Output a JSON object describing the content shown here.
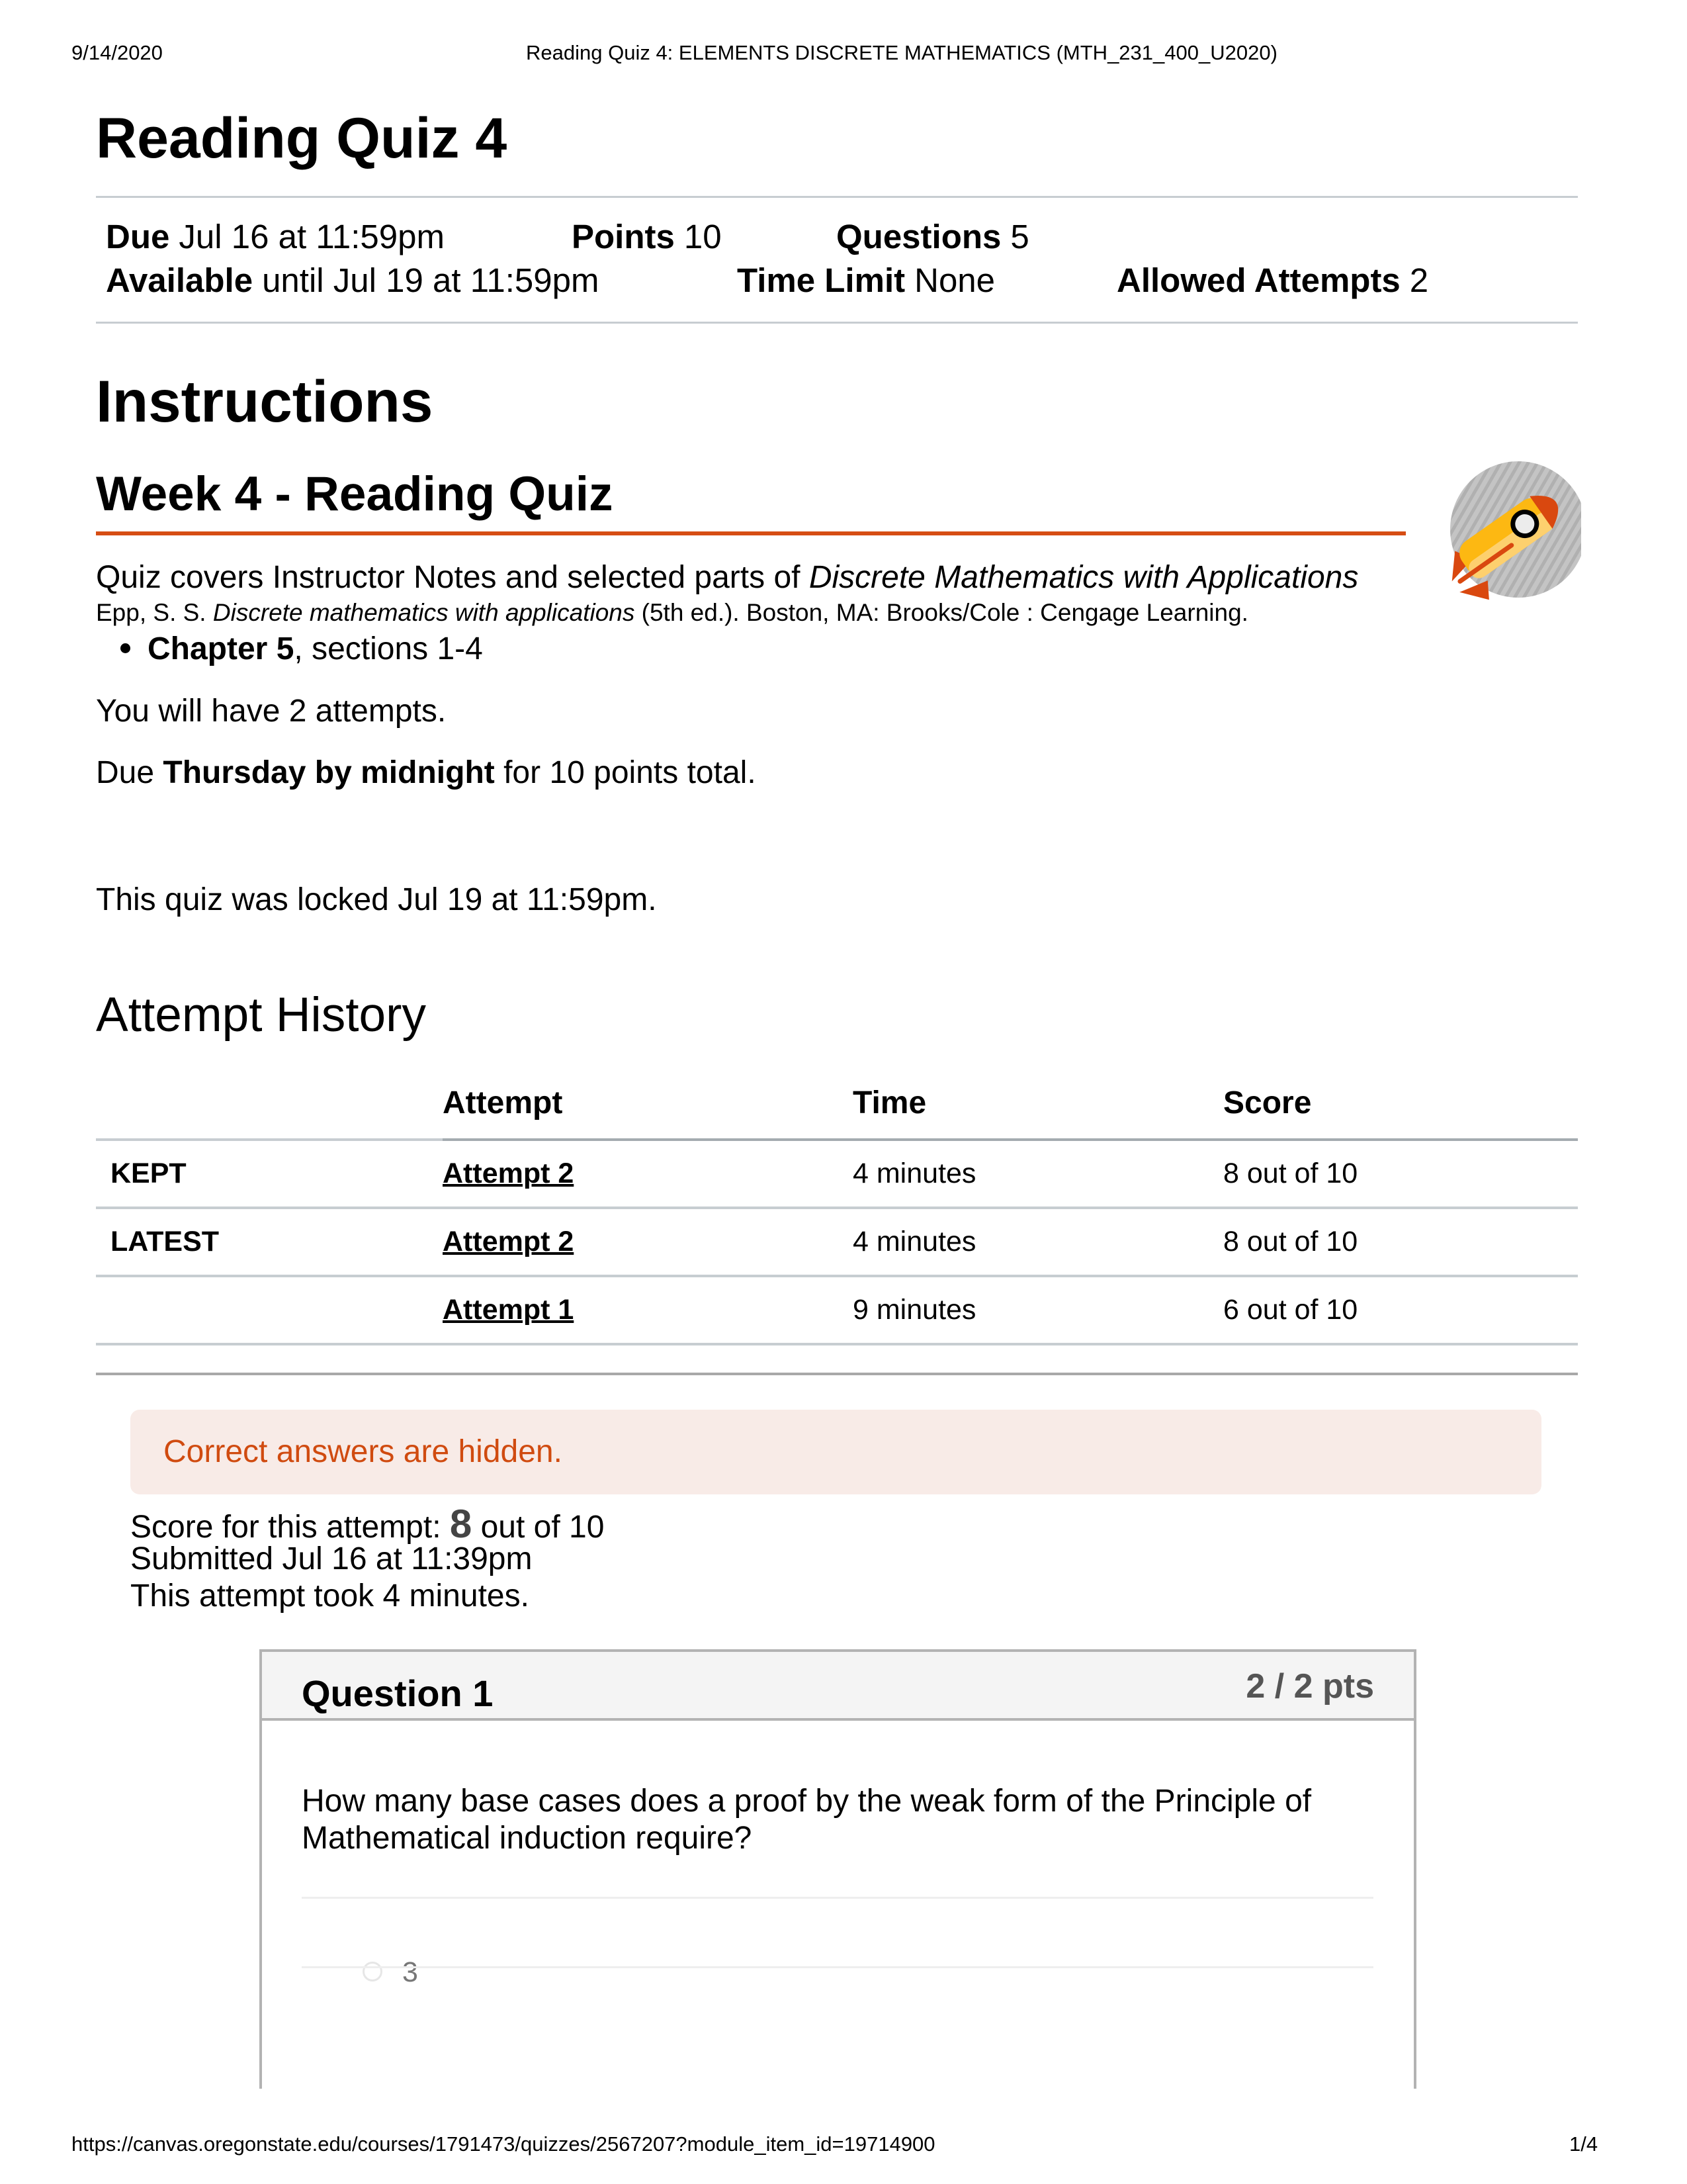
{
  "print_header": {
    "date": "9/14/2020",
    "page_title": "Reading Quiz 4: ELEMENTS DISCRETE MATHEMATICS (MTH_231_400_U2020)"
  },
  "quiz": {
    "title": "Reading Quiz 4",
    "details": {
      "due_label": "Due",
      "due_value": "Jul 16 at 11:59pm",
      "points_label": "Points",
      "points_value": "10",
      "questions_label": "Questions",
      "questions_value": "5",
      "available_label": "Available",
      "available_value": "until Jul 19 at 11:59pm",
      "time_limit_label": "Time Limit",
      "time_limit_value": "None",
      "allowed_attempts_label": "Allowed Attempts",
      "allowed_attempts_value": "2"
    }
  },
  "instructions": {
    "heading": "Instructions",
    "subheading": "Week 4 - Reading Quiz",
    "rocket_icon": "rocket-icon",
    "covers_prefix": "Quiz covers Instructor Notes and selected parts of ",
    "covers_book": "Discrete Mathematics with Applications",
    "citation_author": "Epp, S. S. ",
    "citation_title": "Discrete mathematics with applications",
    "citation_rest": " (5th ed.). Boston, MA: Brooks/Cole : Cengage Learning.",
    "bullet_bold": "Chapter 5",
    "bullet_rest": ", sections 1-4",
    "attempts_text": "You will have 2 attempts.",
    "due_prefix": "Due ",
    "due_bold": "Thursday by midnight",
    "due_suffix": " for 10 points total.",
    "locked_text": "This quiz was locked Jul 19 at 11:59pm."
  },
  "attempt_history": {
    "heading": "Attempt History",
    "columns": [
      "",
      "Attempt",
      "Time",
      "Score"
    ],
    "rows": [
      {
        "label": "KEPT",
        "attempt": "Attempt 2",
        "time": "4 minutes",
        "score": "8 out of 10"
      },
      {
        "label": "LATEST",
        "attempt": "Attempt 2",
        "time": "4 minutes",
        "score": "8 out of 10"
      },
      {
        "label": "",
        "attempt": "Attempt 1",
        "time": "9 minutes",
        "score": "6 out of 10"
      }
    ]
  },
  "submission": {
    "alert": "Correct answers are hidden.",
    "alert_color": "#d04b10",
    "score_prefix": "Score for this attempt: ",
    "score_value": "8",
    "score_suffix": " out of 10",
    "submitted": "Submitted Jul 16 at 11:39pm",
    "duration": "This attempt took 4 minutes."
  },
  "questions": [
    {
      "title": "Question 1",
      "points": "2 / 2 pts",
      "text": "How many base cases does a proof by the weak form of the Principle of Mathematical induction require?",
      "answers": [
        {
          "text": "3",
          "selected": false
        }
      ]
    }
  ],
  "print_footer": {
    "url": "https://canvas.oregonstate.edu/courses/1791473/quizzes/2567207?module_item_id=19714900",
    "page": "1/4"
  }
}
